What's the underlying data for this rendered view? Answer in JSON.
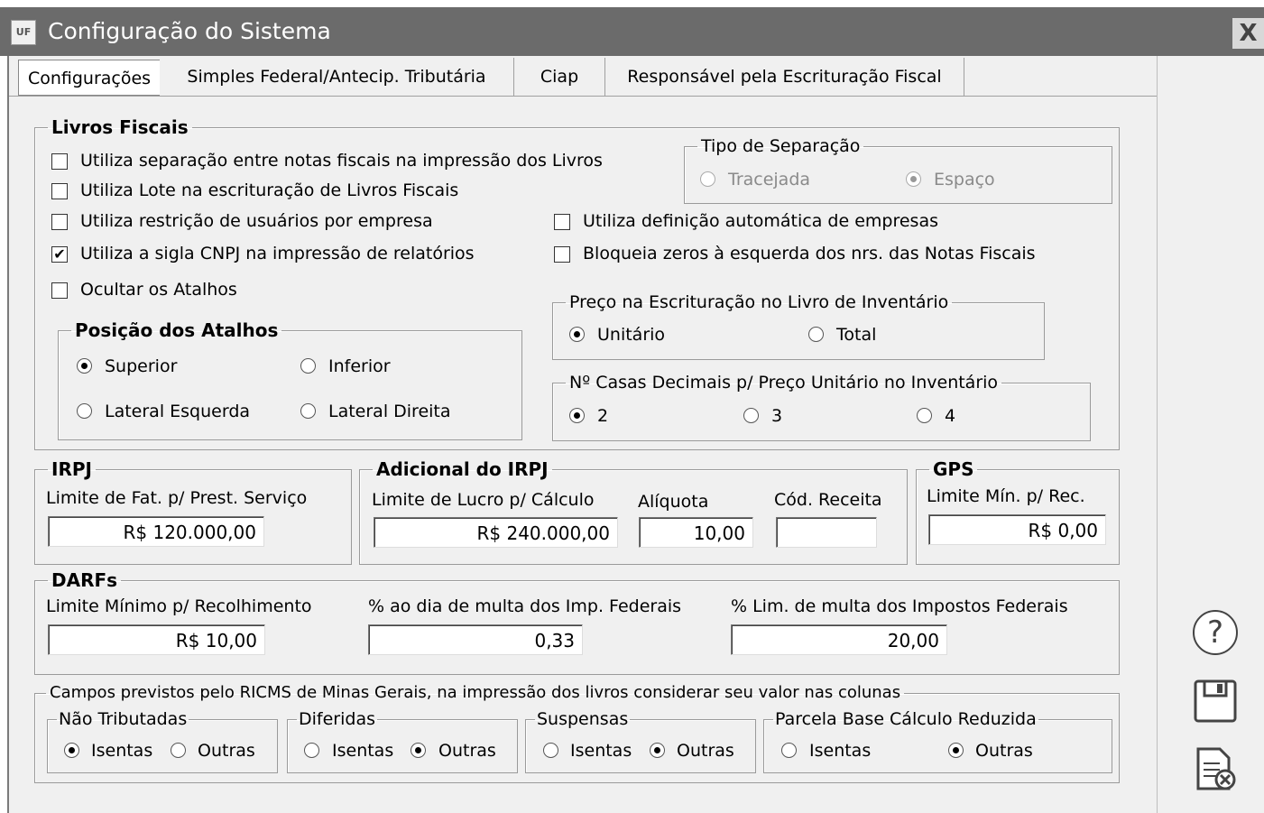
{
  "window": {
    "title": "Configuração do Sistema",
    "icon_text": "UF",
    "close_label": "X"
  },
  "tabs": [
    "Configurações",
    "Simples Federal/Antecip. Tributária",
    "Ciap",
    "Responsável pela Escrituração Fiscal"
  ],
  "livros": {
    "legend": "Livros Fiscais",
    "cb1": "Utiliza separação entre notas fiscais na impressão dos Livros",
    "cb2": "Utiliza Lote na escrituração de Livros Fiscais",
    "cb3": "Utiliza restrição de usuários por empresa",
    "cb4": "Utiliza a sigla CNPJ na impressão de relatórios",
    "cb5": "Ocultar os Atalhos",
    "cb6": "Utiliza definição automática de empresas",
    "cb7": "Bloqueia zeros à esquerda dos nrs. das Notas Fiscais",
    "cb4_checked": "✔",
    "tipo": {
      "legend": "Tipo de Separação",
      "opt1": "Tracejada",
      "opt2": "Espaço"
    },
    "posicao": {
      "legend": "Posição dos Atalhos",
      "opt1": "Superior",
      "opt2": "Inferior",
      "opt3": "Lateral Esquerda",
      "opt4": "Lateral Direita"
    },
    "preco": {
      "legend": "Preço na Escrituração no Livro de Inventário",
      "opt1": "Unitário",
      "opt2": "Total"
    },
    "casas": {
      "legend": "Nº Casas Decimais p/ Preço Unitário no Inventário",
      "opt1": "2",
      "opt2": "3",
      "opt3": "4"
    }
  },
  "irpj": {
    "legend": "IRPJ",
    "label": "Limite de Fat. p/ Prest. Serviço",
    "value": "R$ 120.000,00"
  },
  "adicional": {
    "legend": "Adicional do IRPJ",
    "label1": "Limite de Lucro p/ Cálculo",
    "value1": "R$ 240.000,00",
    "label2": "Alíquota",
    "value2": "10,00",
    "label3": "Cód. Receita",
    "value3": ""
  },
  "gps": {
    "legend": "GPS",
    "label": "Limite Mín. p/ Rec.",
    "value": "R$ 0,00"
  },
  "darfs": {
    "legend": "DARFs",
    "label1": "Limite Mínimo p/ Recolhimento",
    "value1": "R$ 10,00",
    "label2": "% ao dia de multa dos Imp. Federais",
    "value2": "0,33",
    "label3": "% Lim. de multa dos Impostos Federais",
    "value3": "20,00"
  },
  "ricms": {
    "legend": "Campos previstos pelo RICMS de Minas Gerais, na impressão dos livros considerar seu valor nas colunas",
    "nao_trib": "Não Tributadas",
    "diferidas": "Diferidas",
    "suspensas": "Suspensas",
    "parcela": "Parcela Base Cálculo Reduzida",
    "isentas": "Isentas",
    "outras": "Outras"
  },
  "sidebar": {
    "help": "?",
    "save": "💾",
    "cancel": "🗎"
  }
}
